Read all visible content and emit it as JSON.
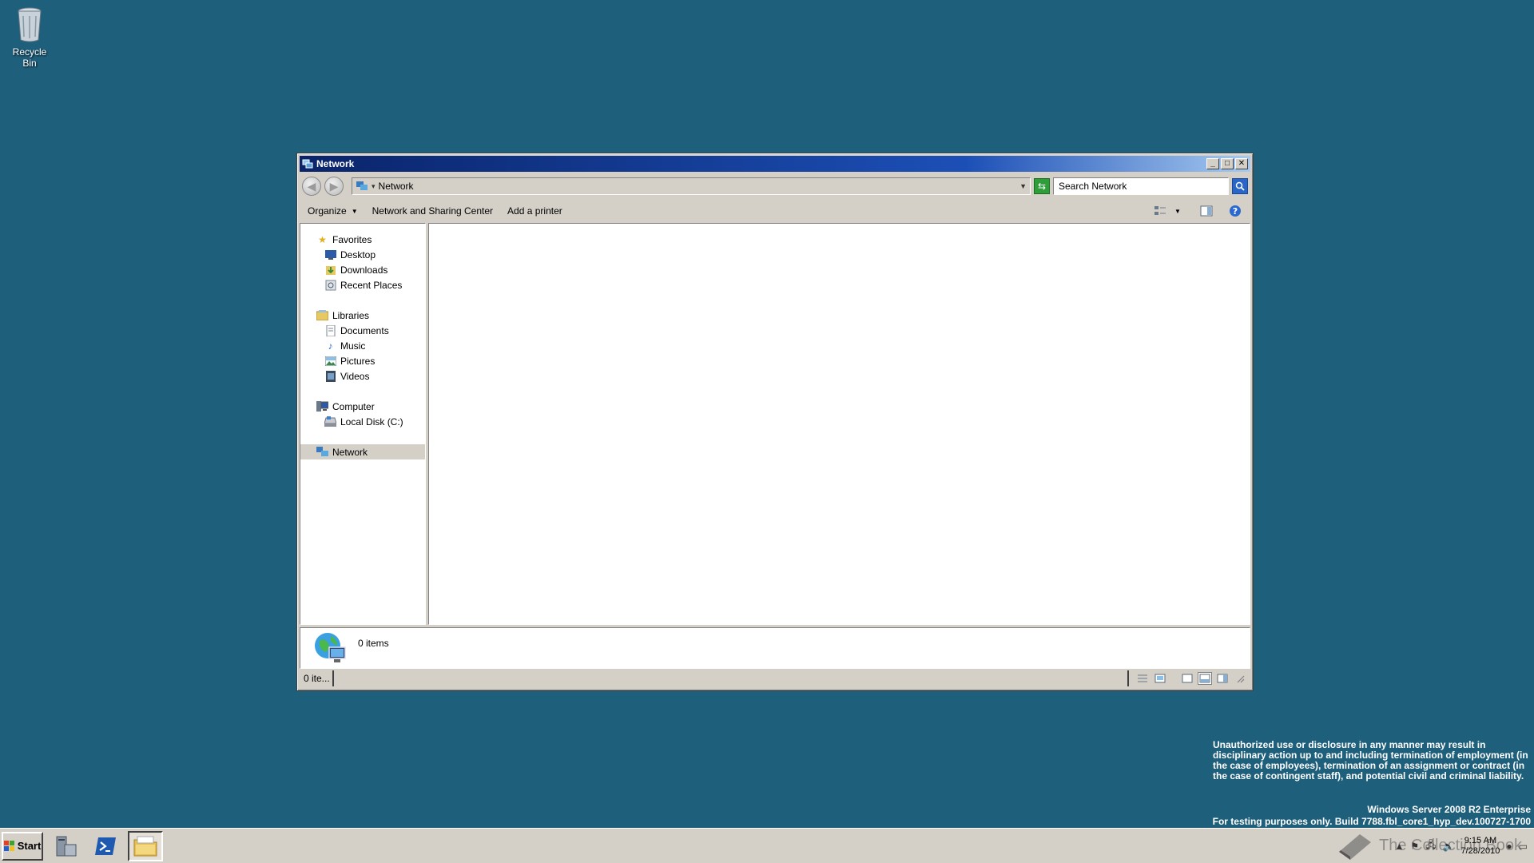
{
  "desktop": {
    "recycle_bin_label": "Recycle Bin"
  },
  "window": {
    "title": "Network",
    "minimize_glyph": "_",
    "maximize_glyph": "□",
    "close_glyph": "✕",
    "address": {
      "path": "Network",
      "search_placeholder": "Search Network"
    },
    "toolbar": {
      "organize": "Organize",
      "network_sharing_center": "Network and Sharing Center",
      "add_printer": "Add a printer"
    },
    "nav": {
      "favorites": "Favorites",
      "desktop": "Desktop",
      "downloads": "Downloads",
      "recent_places": "Recent Places",
      "libraries": "Libraries",
      "documents": "Documents",
      "music": "Music",
      "pictures": "Pictures",
      "videos": "Videos",
      "computer": "Computer",
      "local_disk": "Local Disk (C:)",
      "network": "Network"
    },
    "details": {
      "item_count": "0 items"
    },
    "status": {
      "items": "0 ite..."
    }
  },
  "legal": {
    "notice": "Unauthorized use or disclosure in any manner may result in disciplinary action up to and including termination of employment (in the case of employees), termination of an assignment or contract (in the case of contingent staff), and potential civil and criminal liability.",
    "os": "Windows Server 2008 R2 Enterprise",
    "build": "For testing purposes only. Build 7788.fbl_core1_hyp_dev.100727-1700"
  },
  "taskbar": {
    "start_label": "Start",
    "clock_time": "9:15 AM",
    "clock_date": "7/28/2010"
  },
  "watermark": {
    "text": "The Collection Book"
  },
  "colors": {
    "desktop_bg": "#1e5f7c",
    "titlebar_start": "#0a246a",
    "titlebar_end": "#a6caf0",
    "chrome": "#d4d0c8"
  }
}
